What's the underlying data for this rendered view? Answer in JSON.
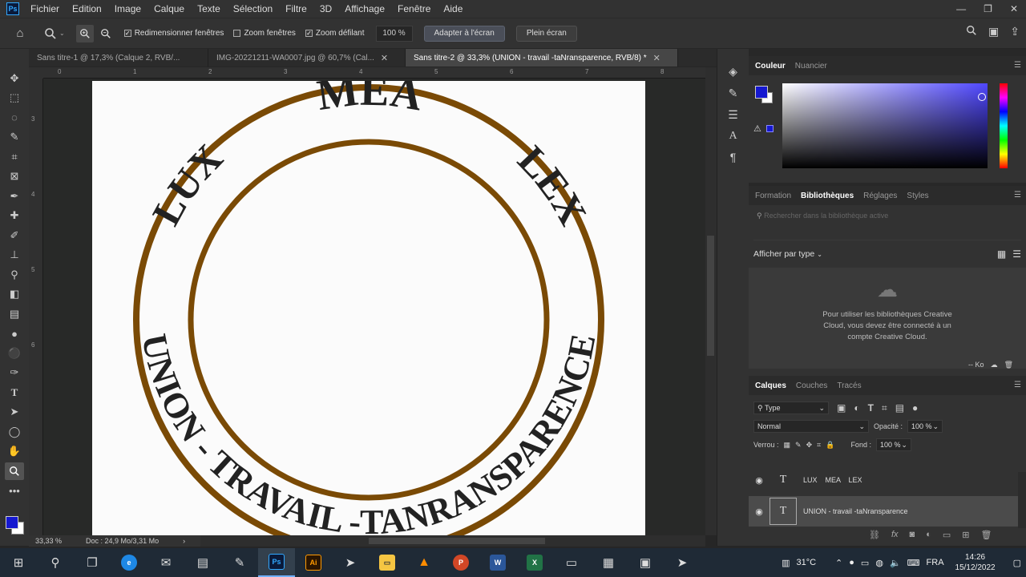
{
  "menu": [
    "Fichier",
    "Edition",
    "Image",
    "Calque",
    "Texte",
    "Sélection",
    "Filtre",
    "3D",
    "Affichage",
    "Fenêtre",
    "Aide"
  ],
  "app_logo": "Ps",
  "options": {
    "resize_windows": "Redimensionner fenêtres",
    "zoom_windows": "Zoom fenêtres",
    "scrubby_zoom": "Zoom défilant",
    "zoom_value": "100 %",
    "fit_screen": "Adapter à l'écran",
    "full_screen": "Plein écran"
  },
  "tabs": [
    {
      "label": "Sans titre-1 @ 17,3% (Calque 2, RVB/...",
      "active": false
    },
    {
      "label": "IMG-20221211-WA0007.jpg @ 60,7% (Cal...",
      "active": false
    },
    {
      "label": "Sans titre-2 @ 33,3% (UNION - travail -taNransparence, RVB/8) *",
      "active": true
    }
  ],
  "ruler_top": [
    "0",
    "1",
    "2",
    "3",
    "4",
    "5",
    "6",
    "7",
    "8"
  ],
  "ruler_left": [
    "3",
    "4",
    "5",
    "6"
  ],
  "seal": {
    "top_text_left": "LUX",
    "top_text_center": "MEA",
    "top_text_right": "LEX",
    "bottom_text": "UNION - TRAVAIL -TANRANSPARENCE",
    "ring_color": "#7a4a05",
    "text_color": "#222222"
  },
  "status": {
    "zoom": "33,33 %",
    "doc": "Doc : 24,9 Mo/3,31 Mo"
  },
  "color_panel": {
    "tabs": [
      "Couleur",
      "Nuancier"
    ],
    "fg": "#1518d0",
    "bg": "#ffffff"
  },
  "library_panel": {
    "tabs": [
      "Formation",
      "Bibliothèques",
      "Réglages",
      "Styles"
    ],
    "search_placeholder": "Rechercher dans la bibliothèque active",
    "view_label": "Afficher par type",
    "message": "Pour utiliser les bibliothèques Creative Cloud, vous devez être connecté à un compte Creative Cloud.",
    "size": "-- Ko"
  },
  "layers_panel": {
    "tabs": [
      "Calques",
      "Couches",
      "Tracés"
    ],
    "filter": "Type",
    "blend_mode": "Normal",
    "opacity_label": "Opacité :",
    "opacity": "100 %",
    "lock_label": "Verrou :",
    "fill_label": "Fond :",
    "fill": "100 %",
    "layers": [
      {
        "name": "LUX    MEA    LEX",
        "selected": false
      },
      {
        "name": "UNION - travail -taNransparence",
        "selected": true
      }
    ]
  },
  "taskbar": {
    "weather": "31°C",
    "lang": "FRA",
    "time": "14:26",
    "date": "15/12/2022"
  }
}
